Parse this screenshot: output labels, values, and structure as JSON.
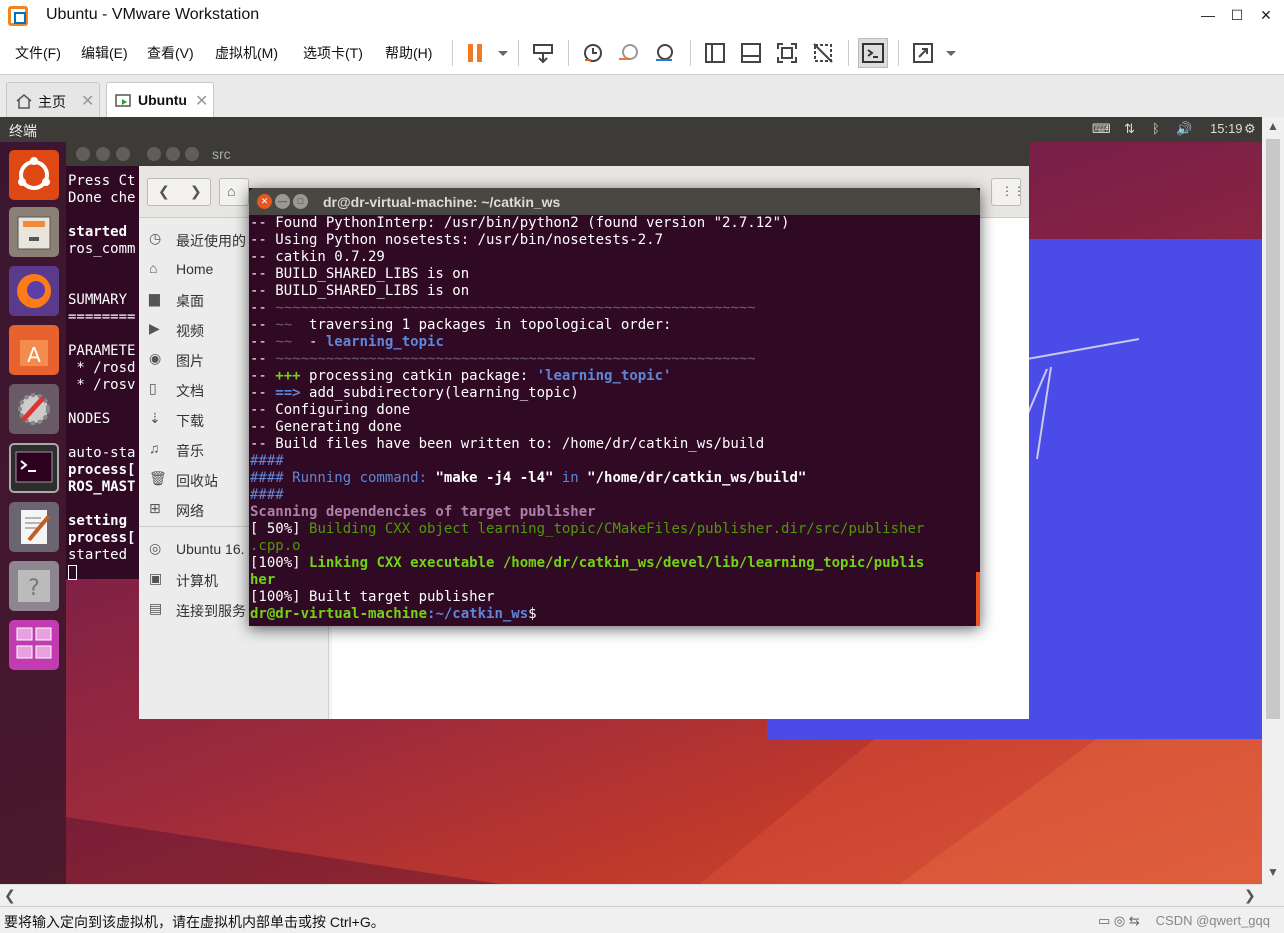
{
  "window": {
    "title": "Ubuntu - VMware Workstation",
    "minimize": "—",
    "maximize": "☐",
    "close": "✕"
  },
  "menu": [
    "文件(F)",
    "编辑(E)",
    "查看(V)",
    "虚拟机(M)",
    "选项卡(T)",
    "帮助(H)"
  ],
  "tabs": [
    {
      "label": "主页",
      "active": false
    },
    {
      "label": "Ubuntu",
      "active": true
    }
  ],
  "ubuntu_topbar": {
    "app_name": "终端",
    "time": "15:19"
  },
  "files_window": {
    "title": "src",
    "sidebar": [
      "最近使用的",
      "Home",
      "桌面",
      "视频",
      "图片",
      "文档",
      "下载",
      "音乐",
      "回收站",
      "网络",
      "Ubuntu 16.",
      "计算机",
      "连接到服务"
    ]
  },
  "back_terminal": {
    "lines": [
      "Press Ct",
      "Done che",
      "",
      "started",
      "ros_comm",
      "",
      "",
      "SUMMARY",
      "========",
      "",
      "PARAMETE",
      " * /rosd",
      " * /rosv",
      "",
      "NODES",
      "",
      "auto-sta",
      "process[",
      "ROS_MAST",
      "",
      "setting",
      "process[",
      "started"
    ]
  },
  "terminal": {
    "title": "dr@dr-virtual-machine: ~/catkin_ws",
    "lines": {
      "l1": "-- Found PythonInterp: /usr/bin/python2 (found version \"2.7.12\")",
      "l2": "-- Using Python nosetests: /usr/bin/nosetests-2.7",
      "l3": "-- catkin 0.7.29",
      "l4": "-- BUILD_SHARED_LIBS is on",
      "l5": "-- BUILD_SHARED_LIBS is on",
      "l6a": "-- ",
      "l6b": "~~~~~~~~~~~~~~~~~~~~~~~~~~~~~~~~~~~~~~~~~~~~~~~~~~~~~~~~~",
      "l7a": "-- ",
      "l7b": "~~",
      "l7c": "  traversing 1 packages in topological order:",
      "l8a": "-- ",
      "l8b": "~~",
      "l8c": "  - ",
      "l8d": "learning_topic",
      "l9a": "-- ",
      "l9b": "~~~~~~~~~~~~~~~~~~~~~~~~~~~~~~~~~~~~~~~~~~~~~~~~~~~~~~~~~",
      "l10a": "-- ",
      "l10b": "+++",
      "l10c": " processing catkin package: ",
      "l10d": "'learning_topic'",
      "l11a": "-- ",
      "l11b": "==>",
      "l11c": " add_subdirectory(learning_topic)",
      "l12": "-- Configuring done",
      "l13": "-- Generating done",
      "l14": "-- Build files have been written to: /home/dr/catkin_ws/build",
      "l15": "####",
      "l16a": "#### Running command: ",
      "l16b": "\"make -j4 -l4\"",
      "l16c": " in ",
      "l16d": "\"/home/dr/catkin_ws/build\"",
      "l17": "####",
      "l18": "Scanning dependencies of target publisher",
      "l19a": "[ 50%] ",
      "l19b": "Building CXX object learning_topic/CMakeFiles/publisher.dir/src/publisher",
      "l20": ".cpp.o",
      "l21a": "[100%] ",
      "l21b": "Linking CXX executable /home/dr/catkin_ws/devel/lib/learning_topic/publis",
      "l22": "her",
      "l23": "[100%] Built target publisher",
      "l24a": "dr@dr-virtual-machine",
      "l24b": ":~/catkin_ws",
      "l24c": "$"
    }
  },
  "statusbar": {
    "message": "要将输入定向到该虚拟机，请在虚拟机内部单击或按 Ctrl+G。",
    "watermark": "CSDN @qwert_gqq"
  },
  "colors": {
    "ubuntu_orange": "#dd4814",
    "terminal_bg": "#300a24",
    "vmware_orange": "#f58220"
  }
}
